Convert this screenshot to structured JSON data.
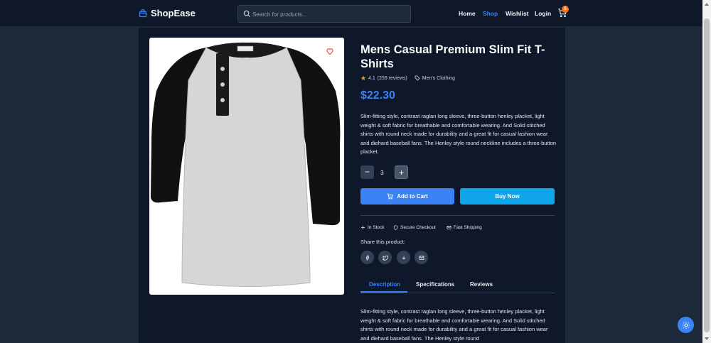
{
  "brand": {
    "name": "ShopEase",
    "icon": "shopping-bag-icon"
  },
  "search": {
    "placeholder": "Search for products..."
  },
  "nav": {
    "home": "Home",
    "shop": "Shop",
    "wishlist": "Wishlist",
    "login": "Login"
  },
  "cart": {
    "count": "5",
    "icon": "cart-icon"
  },
  "product": {
    "title": "Mens Casual Premium Slim Fit T-Shirts",
    "rating": "4.1",
    "reviews": "(259 reviews)",
    "category": "Men's Clothing",
    "price": "$22.30",
    "description": "Slim-fitting style, contrast raglan long sleeve, three-button henley placket, light weight & soft fabric for breathable and comfortable wearing. And Solid stitched shirts with round neck made for durability and a great fit for casual fashion wear and diehard baseball fans. The Henley style round neckline includes a three-button placket.",
    "quantity": "3"
  },
  "buttons": {
    "add_to_cart": "Add to Cart",
    "buy_now": "Buy Now",
    "decrement": "−",
    "increment": "+"
  },
  "features": {
    "stock": "In Stock",
    "checkout": "Secure Checkout",
    "shipping": "Fast Shipping"
  },
  "share": {
    "label": "Share this product:",
    "icons": [
      "facebook-icon",
      "twitter-icon",
      "download-icon",
      "mail-icon"
    ]
  },
  "tabs": {
    "description": "Description",
    "specifications": "Specifications",
    "reviews": "Reviews"
  },
  "description_panel": "Slim-fitting style, contrast raglan long sleeve, three-button henley placket, light weight & soft fabric for breathable and comfortable wearing. And Solid stitched shirts with round neck made for durability and a great fit for casual fashion wear and diehard baseball fans. The Henley style round",
  "colors": {
    "accent": "#3b82f6",
    "buy": "#0ea5e9",
    "background": "#1e293b",
    "panel": "#0f172a",
    "badge": "#f97316",
    "rating_star": "#f59e0b"
  }
}
